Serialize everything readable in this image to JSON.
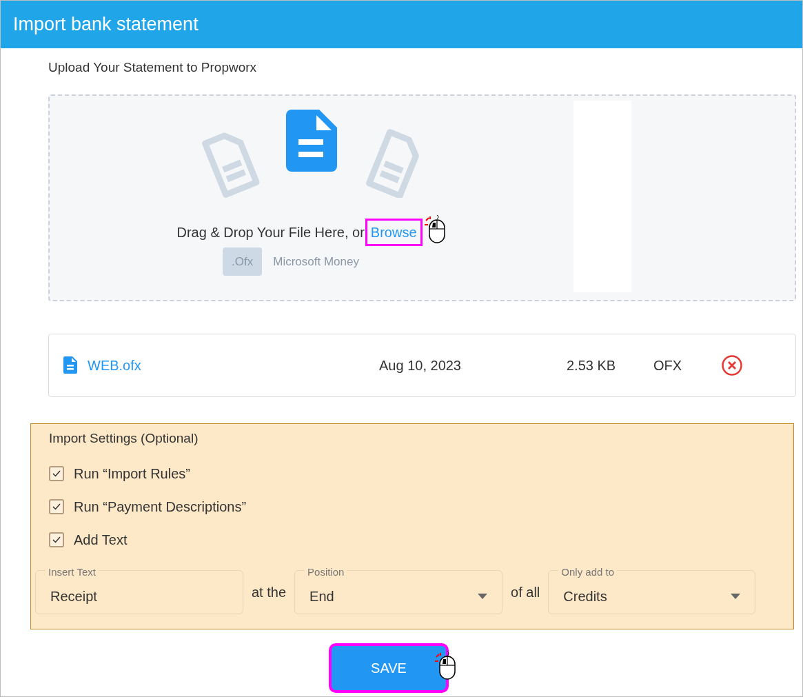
{
  "window": {
    "title": "Import bank statement"
  },
  "upload": {
    "heading": "Upload Your Statement to Propworx",
    "prompt": "Drag & Drop Your File Here, or",
    "browse_link": "Browse",
    "browse_highlighted": true,
    "format_badge": ".Ofx",
    "format_name": "Microsoft Money"
  },
  "files": [
    {
      "name": "WEB.ofx",
      "date": "Aug 10, 2023",
      "size": "2.53 KB",
      "type": "OFX"
    }
  ],
  "settings": {
    "title": "Import Settings (Optional)",
    "options": [
      {
        "label": "Run “Import Rules”",
        "checked": true
      },
      {
        "label": "Run “Payment Descriptions”",
        "checked": true
      },
      {
        "label": "Add Text",
        "checked": true
      }
    ],
    "insert_text": {
      "label": "Insert Text",
      "value": "Receipt"
    },
    "joiner_1": "at the",
    "position": {
      "label": "Position",
      "value": "End"
    },
    "joiner_2": "of all",
    "only_add_to": {
      "label": "Only add to",
      "value": "Credits"
    }
  },
  "save_button": {
    "label": "SAVE",
    "highlighted": true
  }
}
